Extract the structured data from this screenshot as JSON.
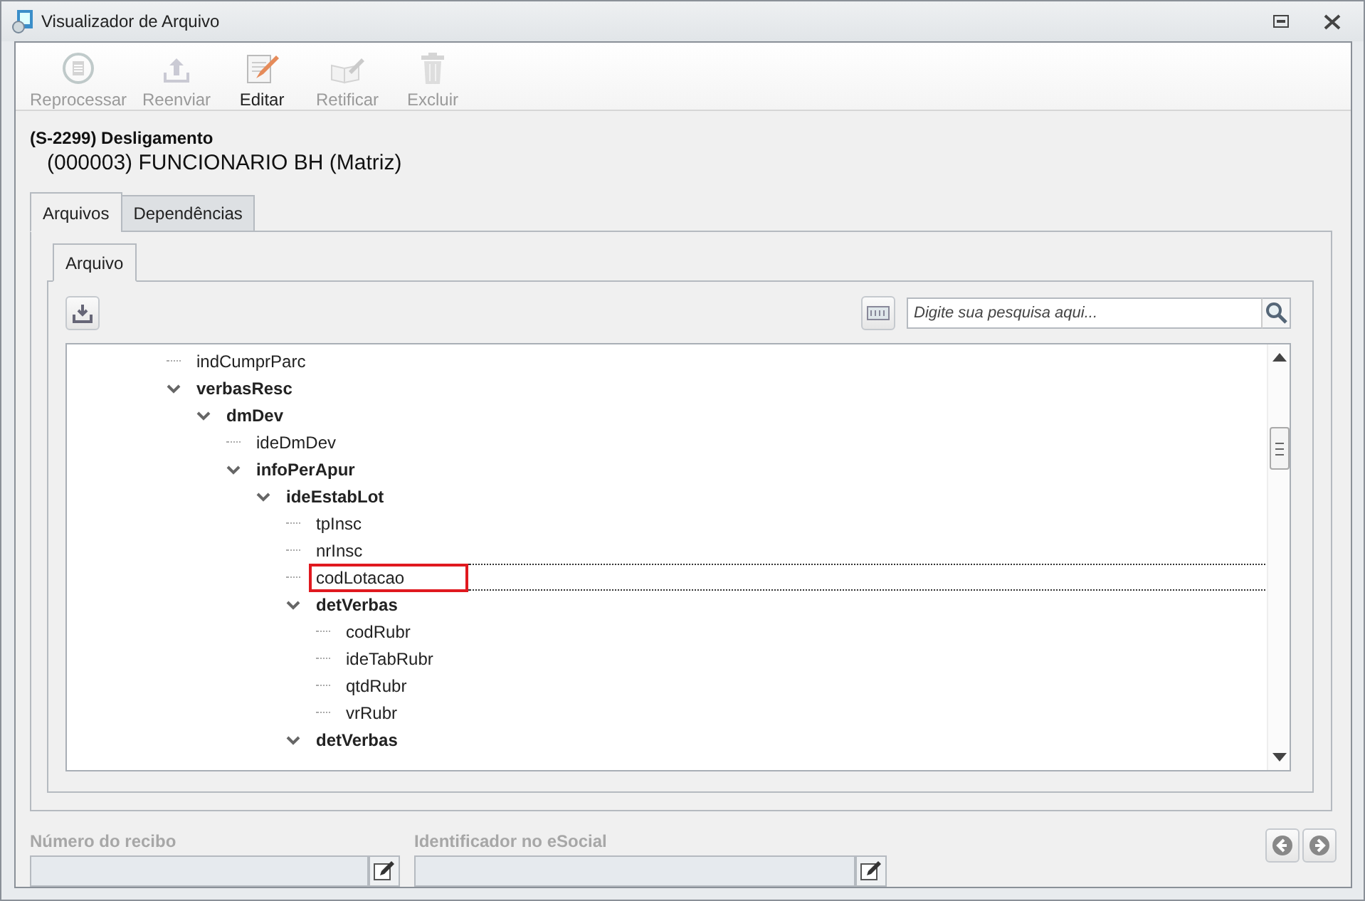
{
  "window": {
    "title": "Visualizador de Arquivo"
  },
  "toolbar": [
    {
      "label": "Reprocessar",
      "kind": "reprocess",
      "disabled": true
    },
    {
      "label": "Reenviar",
      "kind": "upload",
      "disabled": true
    },
    {
      "label": "Editar",
      "kind": "edit",
      "disabled": false
    },
    {
      "label": "Retificar",
      "kind": "rectify",
      "disabled": true
    },
    {
      "label": "Excluir",
      "kind": "delete",
      "disabled": true
    }
  ],
  "event": {
    "title": "(S-2299) Desligamento",
    "subtitle": "(000003) FUNCIONARIO BH (Matriz)"
  },
  "tabs": [
    {
      "label": "Arquivos",
      "selected": true
    },
    {
      "label": "Dependências",
      "selected": false
    }
  ],
  "inner_tabs": [
    {
      "label": "Arquivo",
      "selected": true
    }
  ],
  "search": {
    "placeholder": "Digite sua pesquisa aqui..."
  },
  "tree": [
    {
      "label": "indCumprParc",
      "selected": false
    },
    {
      "label": "verbasResc",
      "selected": false,
      "expanded": true,
      "children": [
        {
          "label": "dmDev",
          "selected": false,
          "expanded": true,
          "children": [
            {
              "label": "ideDmDev",
              "selected": false
            },
            {
              "label": "infoPerApur",
              "selected": false,
              "expanded": true,
              "children": [
                {
                  "label": "ideEstabLot",
                  "selected": false,
                  "expanded": true,
                  "children": [
                    {
                      "label": "tpInsc",
                      "selected": false
                    },
                    {
                      "label": "nrInsc",
                      "selected": false
                    },
                    {
                      "label": "codLotacao",
                      "selected": true
                    },
                    {
                      "label": "detVerbas",
                      "selected": false,
                      "expanded": true,
                      "children": [
                        {
                          "label": "codRubr",
                          "selected": false
                        },
                        {
                          "label": "ideTabRubr",
                          "selected": false
                        },
                        {
                          "label": "qtdRubr",
                          "selected": false
                        },
                        {
                          "label": "vrRubr",
                          "selected": false
                        }
                      ]
                    },
                    {
                      "label": "detVerbas",
                      "selected": false,
                      "expanded": true
                    }
                  ]
                }
              ]
            }
          ]
        }
      ]
    }
  ],
  "fields": [
    {
      "label": "Número do recibo",
      "disabled": true
    },
    {
      "label": "Identificador no eSocial",
      "disabled": true
    }
  ]
}
